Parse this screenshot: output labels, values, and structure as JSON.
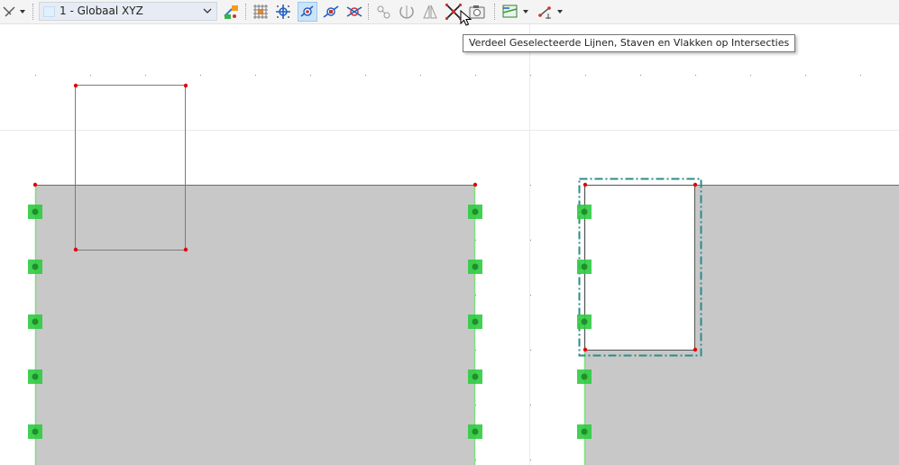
{
  "toolbar": {
    "coordinate_system": {
      "selected": "1 - Globaal XYZ",
      "swatch_color": "#dff0ff"
    },
    "buttons": [
      {
        "id": "view-dropdown",
        "icon": "view-axis-icon"
      },
      {
        "id": "set-work-plane",
        "icon": "work-plane-icon"
      },
      {
        "id": "grid",
        "icon": "grid-icon"
      },
      {
        "id": "snap-grid-points",
        "icon": "snap-grid-icon"
      },
      {
        "id": "snap-objects",
        "icon": "snap-object-icon",
        "active": true
      },
      {
        "id": "snap-midpoints",
        "icon": "snap-midpoint-icon"
      },
      {
        "id": "snap-intersections",
        "icon": "snap-intersection-icon"
      },
      {
        "id": "guide-lines",
        "icon": "guide-lines-icon"
      },
      {
        "id": "rotate",
        "icon": "rotate-icon"
      },
      {
        "id": "mirror",
        "icon": "mirror-icon"
      },
      {
        "id": "divide-at-intersections",
        "icon": "divide-intersection-icon"
      },
      {
        "id": "snapshot-settings",
        "icon": "camera-icon"
      },
      {
        "id": "display-surface",
        "icon": "surface-display-icon"
      },
      {
        "id": "dimension-line",
        "icon": "dimension-line-icon"
      }
    ]
  },
  "tooltip": {
    "text": "Verdeel Geselecteerde Lijnen, Staven en Vlakken op Intersecties"
  },
  "model": {
    "colors": {
      "surface_fill": "#c8c8c8",
      "support": "#2ecc40",
      "node": "#e00000",
      "selection": "#2e8b8b",
      "member_edge": "#7ee07e"
    }
  }
}
